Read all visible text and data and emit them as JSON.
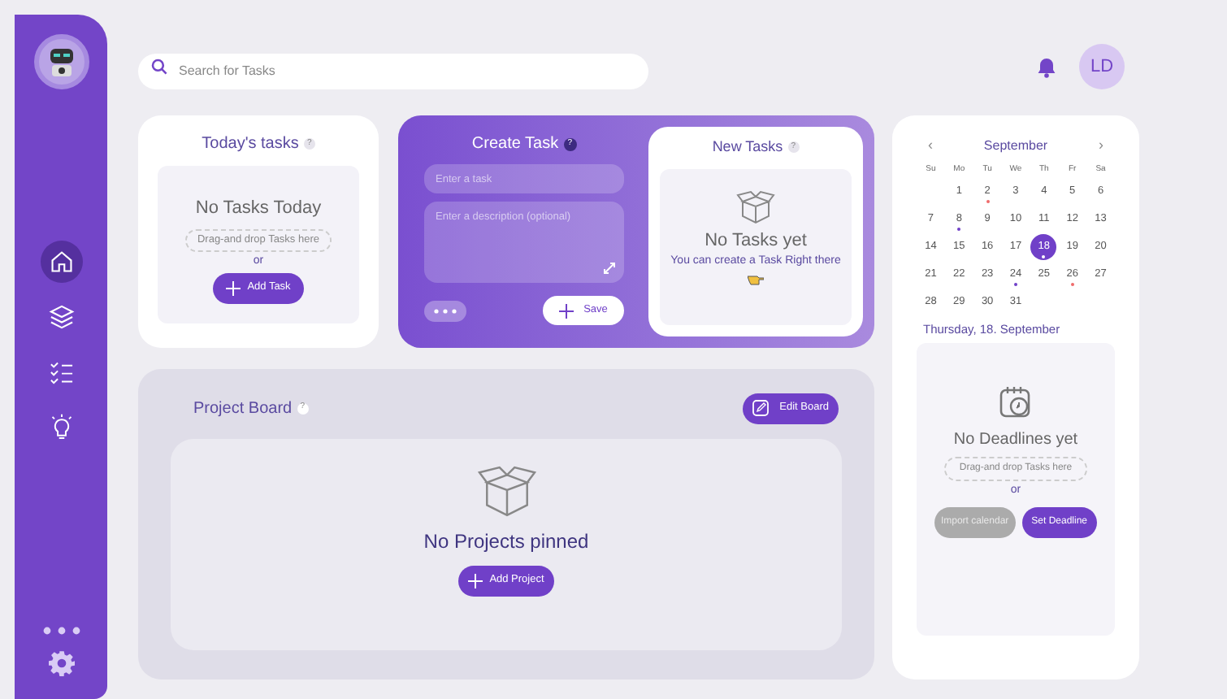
{
  "sidebar": {
    "items": [
      {
        "kind": "home",
        "selected": true
      },
      {
        "kind": "layers",
        "selected": false
      },
      {
        "kind": "checklist",
        "selected": false
      },
      {
        "kind": "bulb",
        "selected": false
      }
    ]
  },
  "search": {
    "placeholder": "Search for Tasks"
  },
  "user": {
    "initials": "LD"
  },
  "today": {
    "title": "Today's tasks",
    "help": "?",
    "empty": "No Tasks Today",
    "drop_hint": "Drag-and drop Tasks here",
    "or": "or",
    "button": "Add Task"
  },
  "create_task": {
    "title": "Create Task",
    "help": "?",
    "task_placeholder": "Enter a task",
    "description_placeholder": "Enter a description (optional)",
    "save": "Save"
  },
  "new_tasks": {
    "title": "New Tasks",
    "help": "?",
    "empty": "No Tasks yet",
    "hint": "You can create a Task Right there"
  },
  "project_board": {
    "title": "Project Board",
    "help": "?",
    "edit": "Edit Board",
    "empty": "No Projects pinned",
    "button": "Add Project"
  },
  "calendar": {
    "month": "September",
    "prev": "‹",
    "next": "›",
    "weekdays": [
      "Su",
      "Mo",
      "Tu",
      "We",
      "Th",
      "Fr",
      "Sa"
    ],
    "days": [
      {
        "label": "1",
        "selected": false
      },
      {
        "label": "2",
        "selected": false,
        "color": "#ef6b6b"
      },
      {
        "label": "3",
        "selected": false
      },
      {
        "label": "4",
        "selected": false
      },
      {
        "label": "5",
        "selected": false
      },
      {
        "label": "6",
        "selected": false
      },
      {
        "label": "7",
        "selected": false
      },
      {
        "label": "8",
        "selected": false,
        "color": "#7040c8"
      },
      {
        "label": "9",
        "selected": false
      },
      {
        "label": "10",
        "selected": false
      },
      {
        "label": "11",
        "selected": false
      },
      {
        "label": "12",
        "selected": false
      },
      {
        "label": "13",
        "selected": false
      },
      {
        "label": "14",
        "selected": false
      },
      {
        "label": "15",
        "selected": false
      },
      {
        "label": "16",
        "selected": false
      },
      {
        "label": "17",
        "selected": false
      },
      {
        "label": "18",
        "selected": true,
        "color": "#ffffff"
      },
      {
        "label": "19",
        "selected": false
      },
      {
        "label": "20",
        "selected": false
      },
      {
        "label": "21",
        "selected": false
      },
      {
        "label": "22",
        "selected": false
      },
      {
        "label": "23",
        "selected": false
      },
      {
        "label": "24",
        "selected": false,
        "color": "#7040c8"
      },
      {
        "label": "25",
        "selected": false
      },
      {
        "label": "26",
        "selected": false,
        "color": "#ef6b6b"
      },
      {
        "label": "27",
        "selected": false
      },
      {
        "label": "28",
        "selected": false
      },
      {
        "label": "29",
        "selected": false
      },
      {
        "label": "30",
        "selected": false
      },
      {
        "label": "31",
        "selected": false
      }
    ],
    "date_title": "Thursday, 18. September",
    "empty": "No Deadlines yet",
    "drop_hint": "Drag-and drop Tasks here",
    "or": "or",
    "import": "Import calendar",
    "set": "Set Deadline"
  }
}
